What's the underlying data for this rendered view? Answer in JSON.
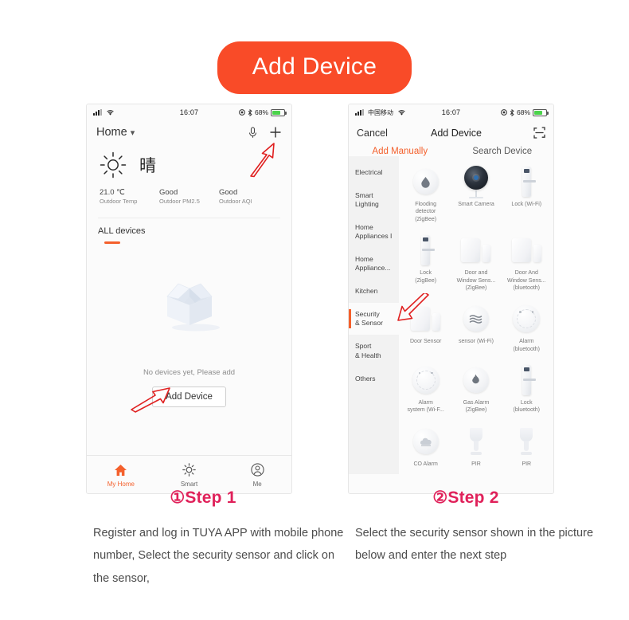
{
  "header": {
    "title": "Add Device",
    "accent": "#f94b28"
  },
  "phone_left": {
    "statusbar": {
      "time": "16:07",
      "battery_pct": "68%",
      "icons": [
        "signal-bars-icon",
        "wifi-icon",
        "location-icon",
        "bluetooth-icon",
        "battery-icon"
      ]
    },
    "nav": {
      "home_label": "Home",
      "chevron": "chevron-down-icon",
      "mic": "microphone-icon",
      "add": "plus-icon"
    },
    "weather": {
      "condition": "晴",
      "icon": "sun-icon",
      "stats": [
        {
          "value": "21.0 ℃",
          "label": "Outdoor Temp"
        },
        {
          "value": "Good",
          "label": "Outdoor PM2.5"
        },
        {
          "value": "Good",
          "label": "Outdoor AQI"
        }
      ]
    },
    "all_devices_label": "ALL devices",
    "empty": {
      "illustration": "open-box-icon",
      "message": "No devices yet, Please add",
      "button": "Add Device"
    },
    "tabbar": [
      {
        "label": "My Home",
        "icon": "home-icon",
        "active": true
      },
      {
        "label": "Smart",
        "icon": "sun-icon",
        "active": false
      },
      {
        "label": "Me",
        "icon": "person-icon",
        "active": false
      }
    ]
  },
  "phone_right": {
    "statusbar": {
      "carrier": "中国移动",
      "time": "16:07",
      "battery_pct": "68%"
    },
    "nav": {
      "cancel": "Cancel",
      "title": "Add Device",
      "scan_icon": "scan-frame-icon"
    },
    "tabs": [
      {
        "label": "Add Manually",
        "active": true
      },
      {
        "label": "Search Device",
        "active": false
      }
    ],
    "categories": [
      {
        "label": "Electrical",
        "active": false
      },
      {
        "label": "Smart\nLighting",
        "active": false
      },
      {
        "label": "Home\nAppliances I",
        "active": false
      },
      {
        "label": "Home\nAppliance...",
        "active": false
      },
      {
        "label": "Kitchen",
        "active": false
      },
      {
        "label": "Security\n& Sensor",
        "active": true
      },
      {
        "label": "Sport\n& Health",
        "active": false
      },
      {
        "label": "Others",
        "active": false
      }
    ],
    "devices": [
      {
        "caption": "Flooding\ndetector\n(ZigBee)",
        "art": "disc-water"
      },
      {
        "caption": "Smart Camera",
        "art": "camera"
      },
      {
        "caption": "Lock (Wi-Fi)",
        "art": "lock"
      },
      {
        "caption": "Lock\n(ZigBee)",
        "art": "lock"
      },
      {
        "caption": "Door and\nWindow Sens...\n(ZigBee)",
        "art": "door-window"
      },
      {
        "caption": "Door And\nWindow Sens...\n(bluetooth)",
        "art": "door-window"
      },
      {
        "caption": "Door Sensor",
        "art": "door-window"
      },
      {
        "caption": "sensor (Wi-Fi)",
        "art": "disc-waves"
      },
      {
        "caption": "Alarm\n(bluetooth)",
        "art": "smoke"
      },
      {
        "caption": "Alarm\nsystem (Wi-F...",
        "art": "smoke"
      },
      {
        "caption": "Gas Alarm\n(ZigBee)",
        "art": "disc-flame"
      },
      {
        "caption": "Lock\n(bluetooth)",
        "art": "lock"
      },
      {
        "caption": "CO Alarm",
        "art": "disc-co"
      },
      {
        "caption": "PIR",
        "art": "pir"
      },
      {
        "caption": "PIR",
        "art": "pir"
      }
    ]
  },
  "steps": [
    {
      "heading": "①Step 1",
      "body": "Register and log in TUYA APP with mobile phone number, Select the security sensor and click on the sensor,"
    },
    {
      "heading": "②Step 2",
      "body": "Select the security sensor shown in the picture below and enter the next step"
    }
  ],
  "annotations": {
    "arrow_color": "#e02020",
    "count": 3
  }
}
